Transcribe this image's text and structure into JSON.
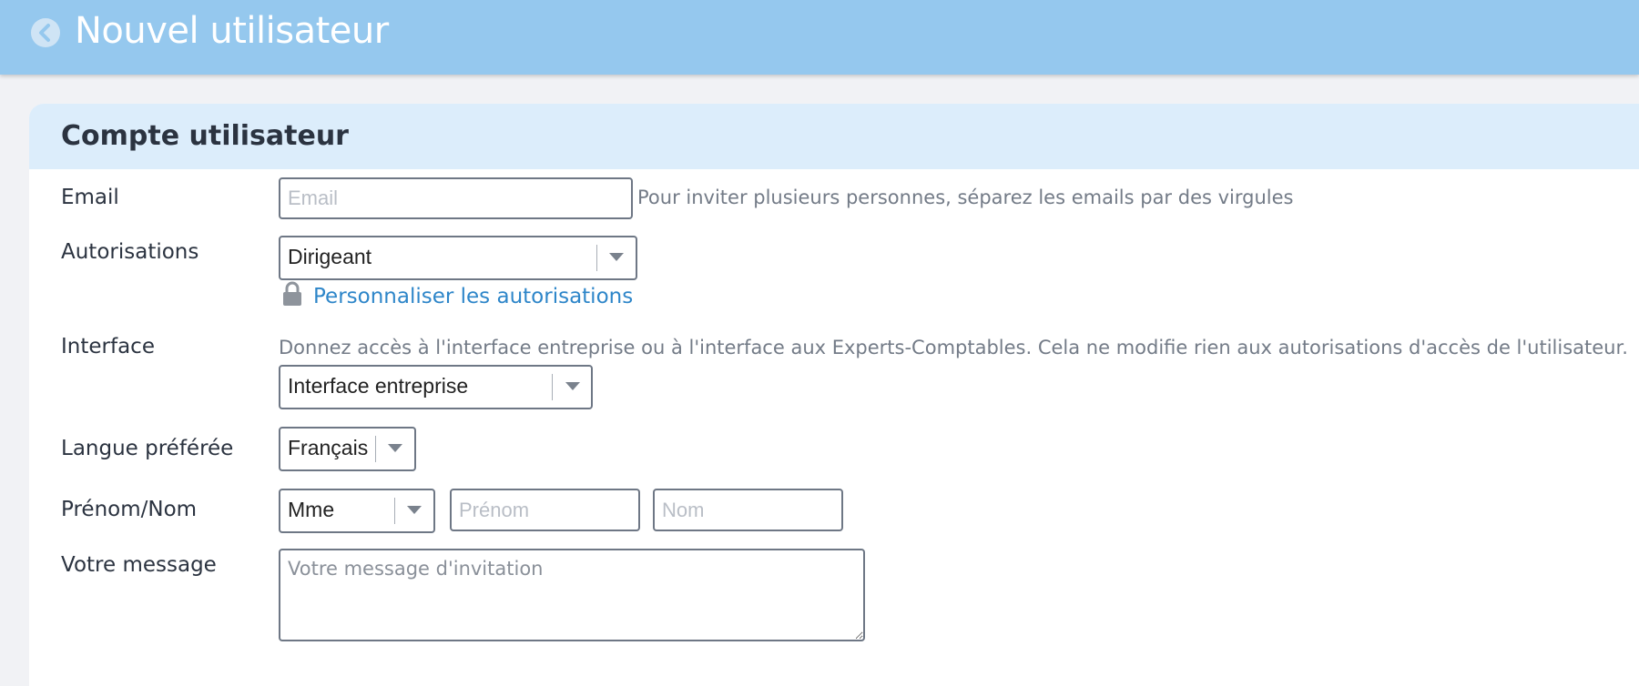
{
  "header": {
    "title": "Nouvel utilisateur",
    "back_icon": "chevron-left-circle-icon"
  },
  "section": {
    "title": "Compte utilisateur"
  },
  "form": {
    "email": {
      "label": "Email",
      "placeholder": "Email",
      "value": "",
      "hint": "Pour inviter plusieurs personnes, séparez les emails par des virgules"
    },
    "autorisations": {
      "label": "Autorisations",
      "selected": "Dirigeant",
      "customize_link": "Personnaliser les autorisations",
      "customize_icon": "lock-icon"
    },
    "interface": {
      "label": "Interface",
      "hint": "Donnez accès à l'interface entreprise ou à l'interface aux Experts-Comptables. Cela ne modifie rien aux autorisations d'accès de l'utilisateur.",
      "selected": "Interface entreprise"
    },
    "langue": {
      "label": "Langue préférée",
      "selected": "Français"
    },
    "nom": {
      "label": "Prénom/Nom",
      "civilite_selected": "Mme",
      "prenom_placeholder": "Prénom",
      "nom_placeholder": "Nom"
    },
    "message": {
      "label": "Votre message",
      "placeholder": "Votre message d'invitation"
    }
  },
  "colors": {
    "topbar": "#95c8ee",
    "section_header": "#dcedfb",
    "link": "#2e86c9"
  }
}
